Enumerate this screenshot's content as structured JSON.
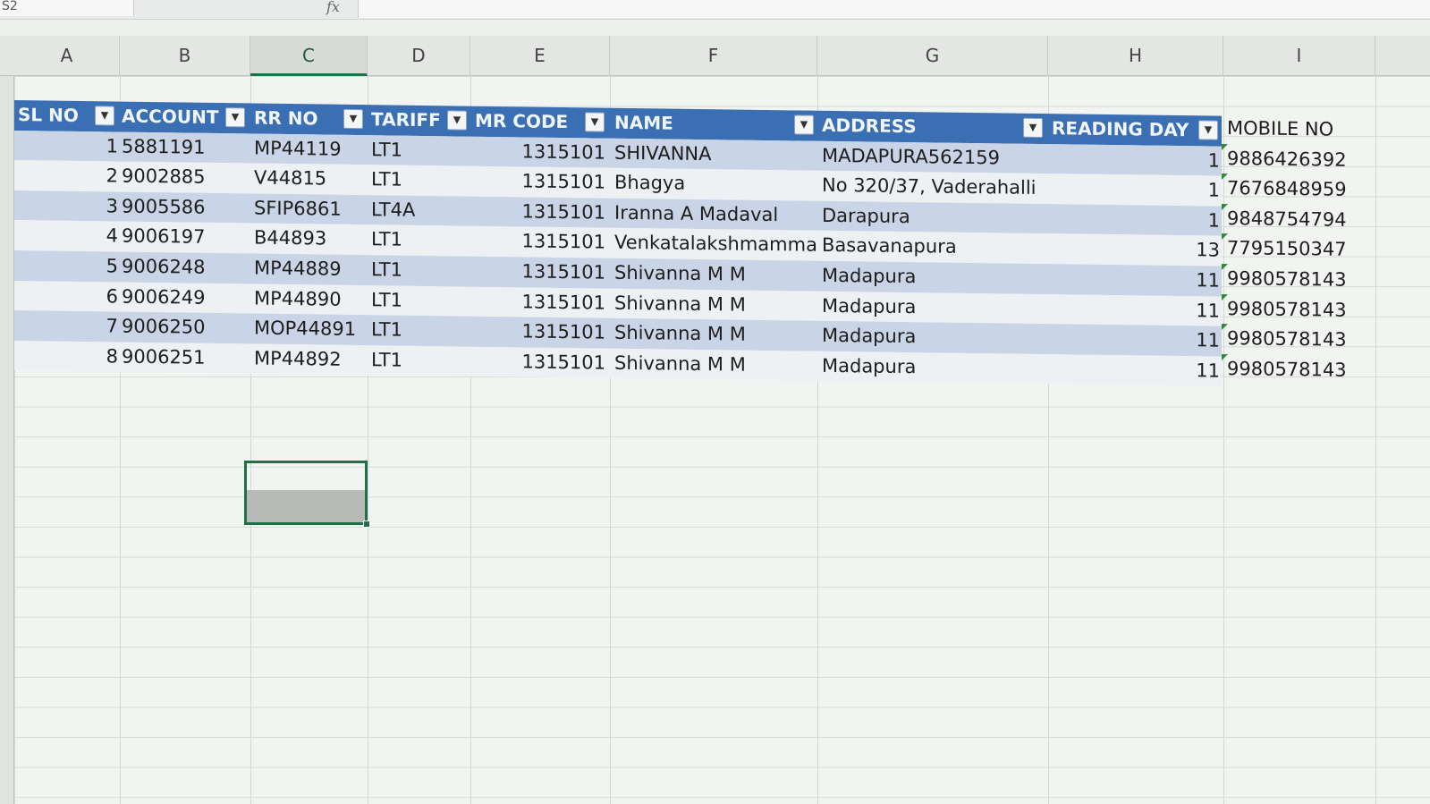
{
  "formula_bar": {
    "name_box": "S2",
    "fx_label": "fx",
    "formula": ""
  },
  "columns": [
    "A",
    "B",
    "C",
    "D",
    "E",
    "F",
    "G",
    "H",
    "I"
  ],
  "table": {
    "headers": [
      "SL NO",
      "ACCOUNT",
      "RR NO",
      "TARIFF",
      "MR CODE",
      "NAME",
      "ADDRESS",
      "READING DAY"
    ],
    "rows": [
      [
        "1",
        "5881191",
        "MP44119",
        "LT1",
        "1315101",
        "SHIVANNA",
        "MADAPURA562159",
        "1"
      ],
      [
        "2",
        "9002885",
        "V44815",
        "LT1",
        "1315101",
        "Bhagya",
        "No 320/37, Vaderahalli",
        "1"
      ],
      [
        "3",
        "9005586",
        "SFIP6861",
        "LT4A",
        "1315101",
        "Iranna A Madaval",
        "Darapura",
        "1"
      ],
      [
        "4",
        "9006197",
        "B44893",
        "LT1",
        "1315101",
        "Venkatalakshmamma",
        "Basavanapura",
        "13"
      ],
      [
        "5",
        "9006248",
        "MP44889",
        "LT1",
        "1315101",
        "Shivanna M M",
        "Madapura",
        "11"
      ],
      [
        "6",
        "9006249",
        "MP44890",
        "LT1",
        "1315101",
        "Shivanna M M",
        "Madapura",
        "11"
      ],
      [
        "7",
        "9006250",
        "MOP44891",
        "LT1",
        "1315101",
        "Shivanna M M",
        "Madapura",
        "11"
      ],
      [
        "8",
        "9006251",
        "MP44892",
        "LT1",
        "1315101",
        "Shivanna M M",
        "Madapura",
        "11"
      ]
    ],
    "mobile_header": "MOBILE NO",
    "mobile": [
      "9886426392",
      "7676848959",
      "9848754794",
      "7795150347",
      "9980578143",
      "9980578143",
      "9980578143",
      "9980578143"
    ],
    "filter_glyph": "▼",
    "filter_active_glyph": "▼"
  },
  "colors": {
    "header_bg": "#3a6fb3",
    "band_bg": "#c9d5e6",
    "selection": "#1e7145"
  }
}
